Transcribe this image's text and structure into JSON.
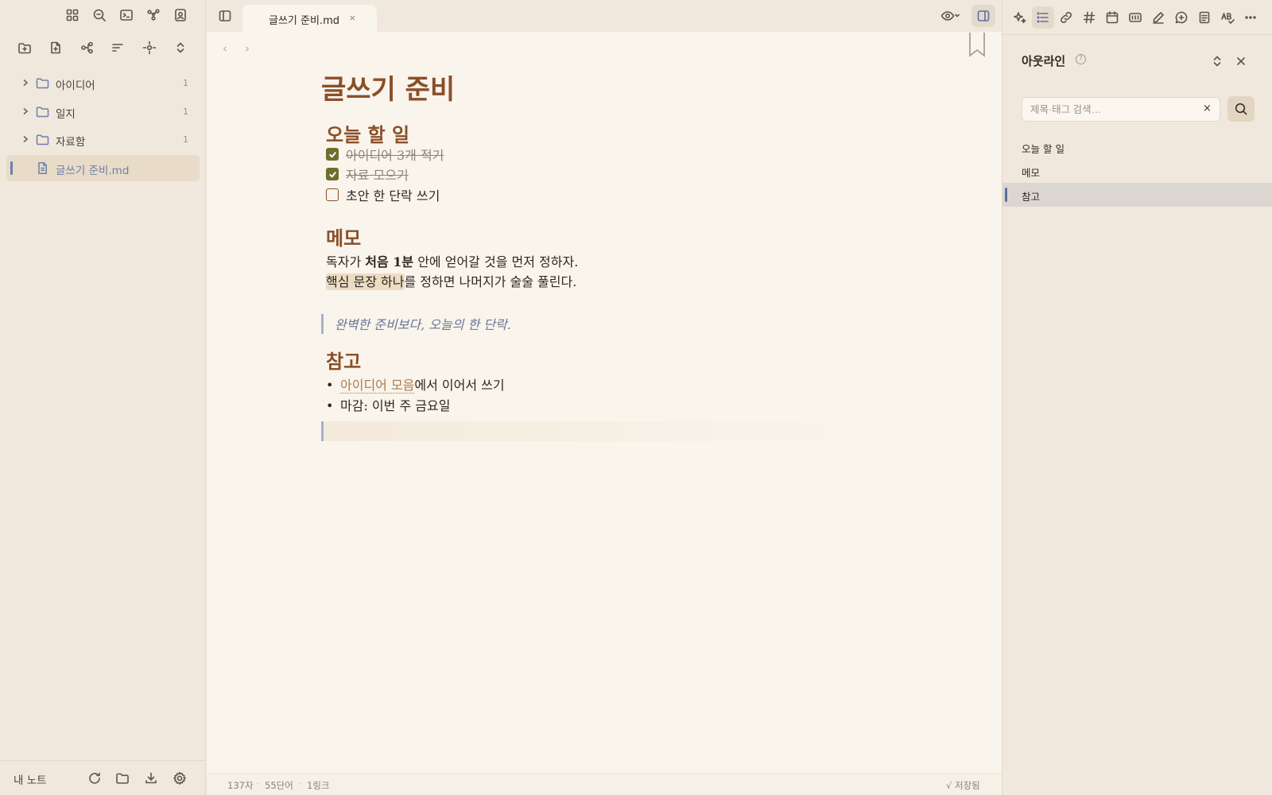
{
  "app": {
    "vault_name": "내 노트",
    "colors": {
      "accent": "#6d7fab",
      "heading": "#8a4f28",
      "checkbox": "#6e6f2c",
      "background": "#f9f4ec",
      "sidebar": "#f0e8dc"
    }
  },
  "left_toolbar": {
    "icons": [
      "grid-icon",
      "zoom-search-icon",
      "terminal-icon",
      "graph-icon",
      "contact-card-icon"
    ]
  },
  "file_actions": {
    "icons": [
      "new-folder-icon",
      "new-note-icon",
      "hierarchy-icon",
      "sort-icon",
      "reveal-target-icon",
      "expand-collapse-icon"
    ]
  },
  "tree": {
    "items": [
      {
        "type": "folder",
        "label": "아이디어",
        "count": "1"
      },
      {
        "type": "folder",
        "label": "일지",
        "count": "1"
      },
      {
        "type": "folder",
        "label": "자료함",
        "count": "1"
      },
      {
        "type": "file",
        "label": "글쓰기 준비.md",
        "active": true
      }
    ]
  },
  "left_footer": {
    "icons": [
      "refresh-icon",
      "folder-icon",
      "download-icon",
      "settings-icon"
    ]
  },
  "tab": {
    "title": "글쓰기 준비.md",
    "close": "×"
  },
  "nav": {
    "back": "‹",
    "forward": "›"
  },
  "document": {
    "title": "글쓰기 준비",
    "sections": [
      {
        "heading": "오늘 할 일"
      },
      {
        "heading": "메모"
      },
      {
        "heading": "참고"
      }
    ],
    "tasks": [
      {
        "text": "아이디어 3개 적기",
        "done": true
      },
      {
        "text": "자료 모으기",
        "done": true
      },
      {
        "text": "초안 한 단락 쓰기",
        "done": false
      }
    ],
    "memo": {
      "line1_a": "독자가 ",
      "line1_bold": "처음 1분",
      "line1_b": " 안에 얻어갈 것을 먼저 정하자.",
      "line2_highlight": "핵심 문장 하나",
      "line2_rest": "를 정하면 나머지가 술술 풀린다."
    },
    "quote": "완벽한 준비보다, 오늘의 한 단락.",
    "references": {
      "bullet": "•",
      "item1_link": "아이디어 모음",
      "item1_rest": "에서 이어서 쓰기",
      "item2": "마감: 이번 주 금요일"
    }
  },
  "status": {
    "chars": "137자",
    "words": "55단어",
    "links": "1링크",
    "separator": "·",
    "saved": "√ 저장됨"
  },
  "right_panel": {
    "toolbar_icons": [
      "sparkle-icon",
      "outline-list-icon",
      "link-icon",
      "hashtag-icon",
      "calendar-icon",
      "kanban-icon",
      "pen-icon",
      "comment-plus-icon",
      "document-icon",
      "spellcheck-icon",
      "more-icon"
    ],
    "active_tool": "outline-list-icon",
    "outline": {
      "title": "아웃라인",
      "help": "?",
      "search_placeholder": "제목·태그 검색…",
      "clear": "×",
      "items": [
        {
          "label": "오늘 할 일",
          "active": false
        },
        {
          "label": "메모",
          "active": false
        },
        {
          "label": "참고",
          "active": true
        }
      ]
    }
  }
}
